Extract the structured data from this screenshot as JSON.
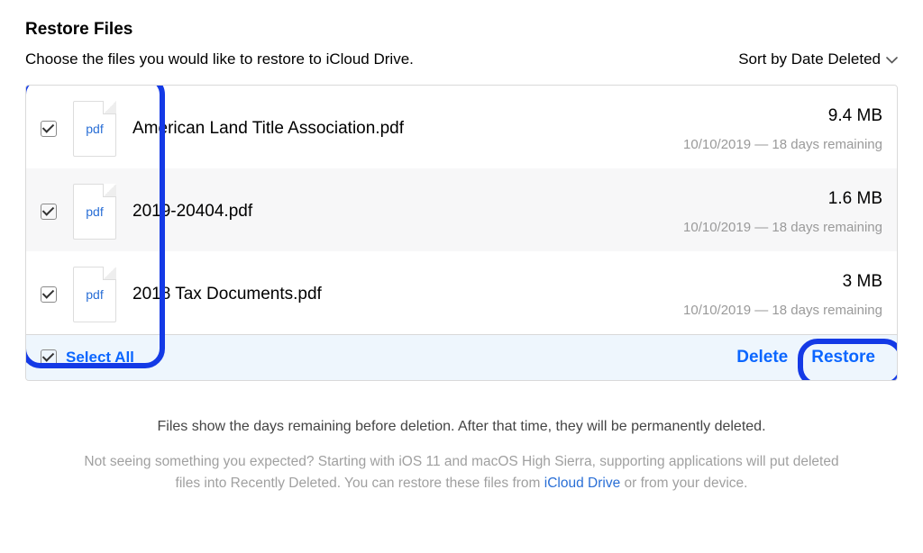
{
  "header": {
    "title": "Restore Files",
    "description": "Choose the files you would like to restore to iCloud Drive.",
    "sort_label": "Sort by Date Deleted"
  },
  "files": [
    {
      "checked": true,
      "ext": "pdf",
      "name": "American Land Title Association.pdf",
      "size": "9.4 MB",
      "deleted": "10/10/2019 — 18 days remaining"
    },
    {
      "checked": true,
      "ext": "pdf",
      "name": "2019-20404.pdf",
      "size": "1.6 MB",
      "deleted": "10/10/2019 — 18 days remaining"
    },
    {
      "checked": true,
      "ext": "pdf",
      "name": "2018 Tax Documents.pdf",
      "size": "3 MB",
      "deleted": "10/10/2019 — 18 days remaining"
    }
  ],
  "actions": {
    "select_all_label": "Select All",
    "select_all_checked": true,
    "delete_label": "Delete",
    "restore_label": "Restore"
  },
  "footer": {
    "line1": "Files show the days remaining before deletion. After that time, they will be permanently deleted.",
    "line2_a": "Not seeing something you expected? Starting with iOS 11 and macOS High Sierra, supporting applications will put deleted files into Recently Deleted. You can restore these files from ",
    "link_label": "iCloud Drive",
    "line2_b": " or from your device."
  }
}
